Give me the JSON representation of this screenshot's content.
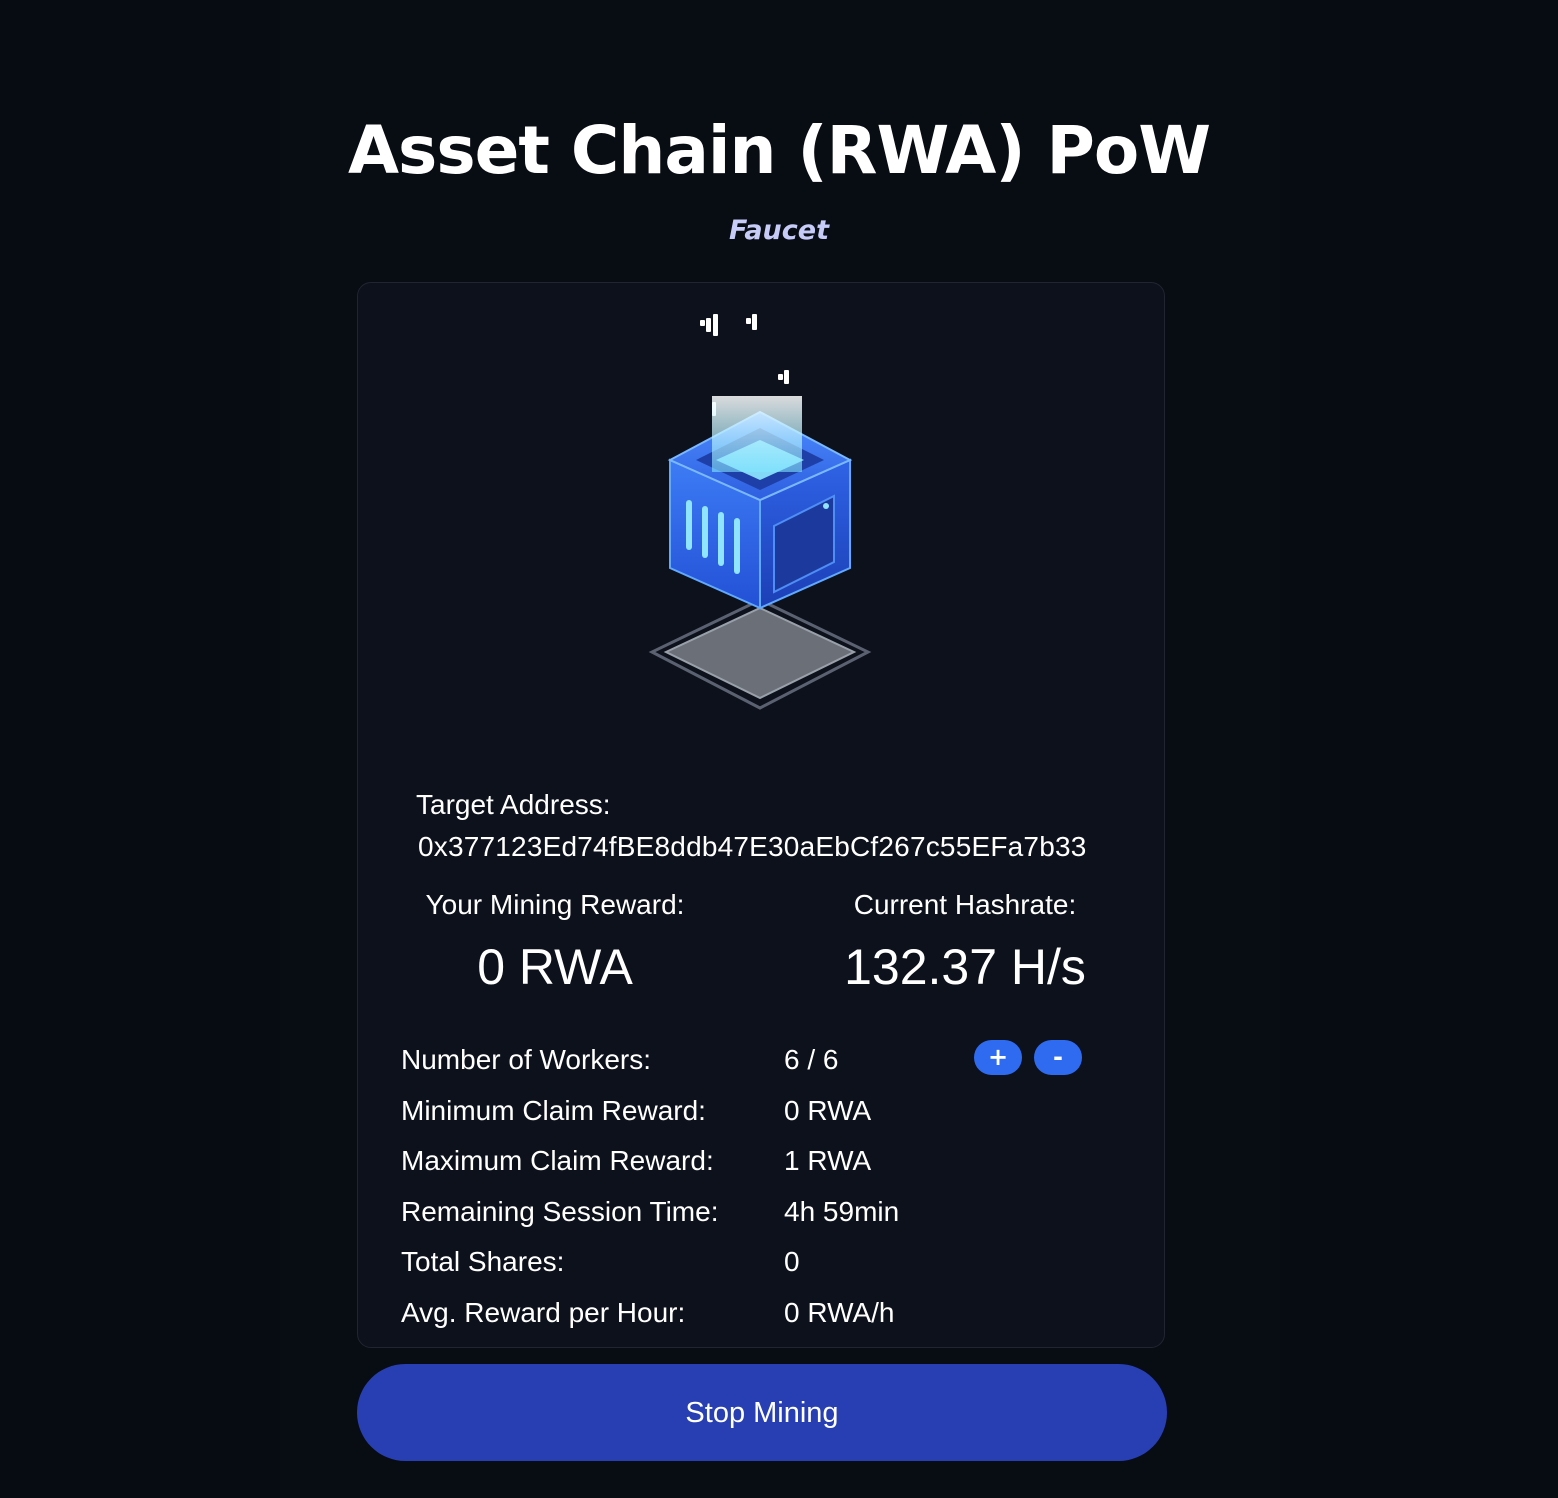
{
  "header": {
    "title": "Asset Chain (RWA) PoW",
    "subtitle": "Faucet"
  },
  "address": {
    "label": "Target Address:",
    "value": "0x377123Ed74fBE8ddb47E30aEbCf267c55EFa7b33"
  },
  "stats": {
    "reward_label": "Your Mining Reward:",
    "reward_value": "0 RWA",
    "hashrate_label": "Current Hashrate:",
    "hashrate_value": "132.37 H/s"
  },
  "info": [
    {
      "key": "Number of Workers:",
      "value": "6 / 6"
    },
    {
      "key": "Minimum Claim Reward:",
      "value": "0 RWA"
    },
    {
      "key": "Maximum Claim Reward:",
      "value": "1 RWA"
    },
    {
      "key": "Remaining Session Time:",
      "value": "4h 59min"
    },
    {
      "key": "Total Shares:",
      "value": "0"
    },
    {
      "key": "Avg. Reward per Hour:",
      "value": "0 RWA/h"
    }
  ],
  "workers_controls": {
    "plus_label": "+",
    "minus_label": "-"
  },
  "actions": {
    "stop_label": "Stop Mining"
  },
  "colors": {
    "background": "#070b12",
    "card": "#0c111b",
    "accent_button": "#283fb3",
    "small_button": "#2f6bf0",
    "subtitle": "#c7cbf7"
  },
  "icons": {
    "illustration": "mining-cube-icon"
  }
}
